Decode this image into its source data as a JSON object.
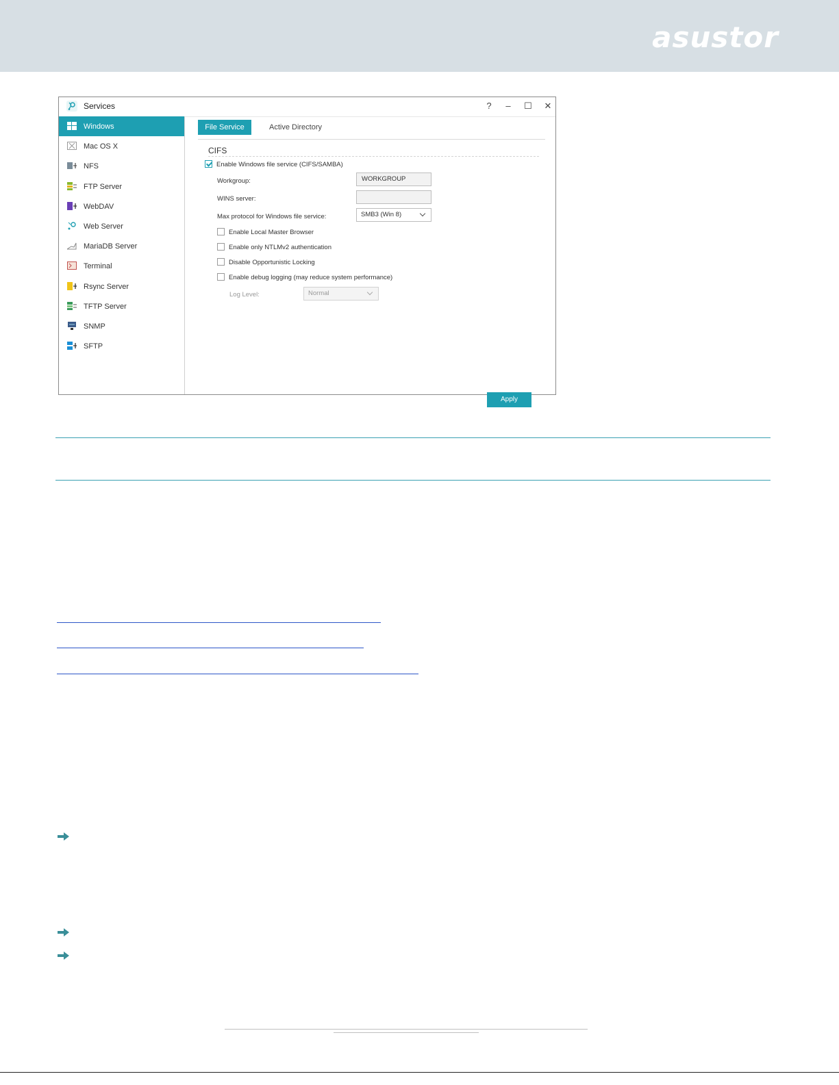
{
  "brand": {
    "logo_text": "asustor"
  },
  "window": {
    "title": "Services",
    "controls": {
      "help": "?",
      "minimize": "–",
      "maximize": "☐",
      "close": "✕"
    }
  },
  "sidebar": {
    "items": [
      {
        "label": "Windows",
        "icon": "windows-icon",
        "active": true
      },
      {
        "label": "Mac OS X",
        "icon": "macos-icon"
      },
      {
        "label": "NFS",
        "icon": "nfs-icon"
      },
      {
        "label": "FTP Server",
        "icon": "ftp-server-icon"
      },
      {
        "label": "WebDAV",
        "icon": "webdav-icon"
      },
      {
        "label": "Web Server",
        "icon": "web-server-icon"
      },
      {
        "label": "MariaDB Server",
        "icon": "mariadb-icon"
      },
      {
        "label": "Terminal",
        "icon": "terminal-icon"
      },
      {
        "label": "Rsync Server",
        "icon": "rsync-icon"
      },
      {
        "label": "TFTP Server",
        "icon": "tftp-icon"
      },
      {
        "label": "SNMP",
        "icon": "snmp-icon"
      },
      {
        "label": "SFTP",
        "icon": "sftp-icon"
      }
    ]
  },
  "tabs": {
    "file_service": "File Service",
    "active_directory": "Active Directory"
  },
  "cifs": {
    "title": "CIFS",
    "enable_label": "Enable Windows file service (CIFS/SAMBA)",
    "enable_checked": true,
    "workgroup_label": "Workgroup:",
    "workgroup_value": "WORKGROUP",
    "wins_label": "WINS server:",
    "wins_value": "",
    "max_protocol_label": "Max protocol for Windows file service:",
    "max_protocol_value": "SMB3 (Win 8)",
    "options": [
      {
        "label": "Enable Local Master Browser",
        "checked": false
      },
      {
        "label": "Enable only NTLMv2 authentication",
        "checked": false
      },
      {
        "label": "Disable Opportunistic Locking",
        "checked": false
      },
      {
        "label": "Enable debug logging (may reduce system performance)",
        "checked": false
      }
    ],
    "log_level_label": "Log Level:",
    "log_level_value": "Normal"
  },
  "apply_label": "Apply",
  "colors": {
    "accent": "#1e9fb2",
    "band": "#d7dfe4",
    "link": "#2b55c8",
    "arrow": "#3a8f99"
  }
}
